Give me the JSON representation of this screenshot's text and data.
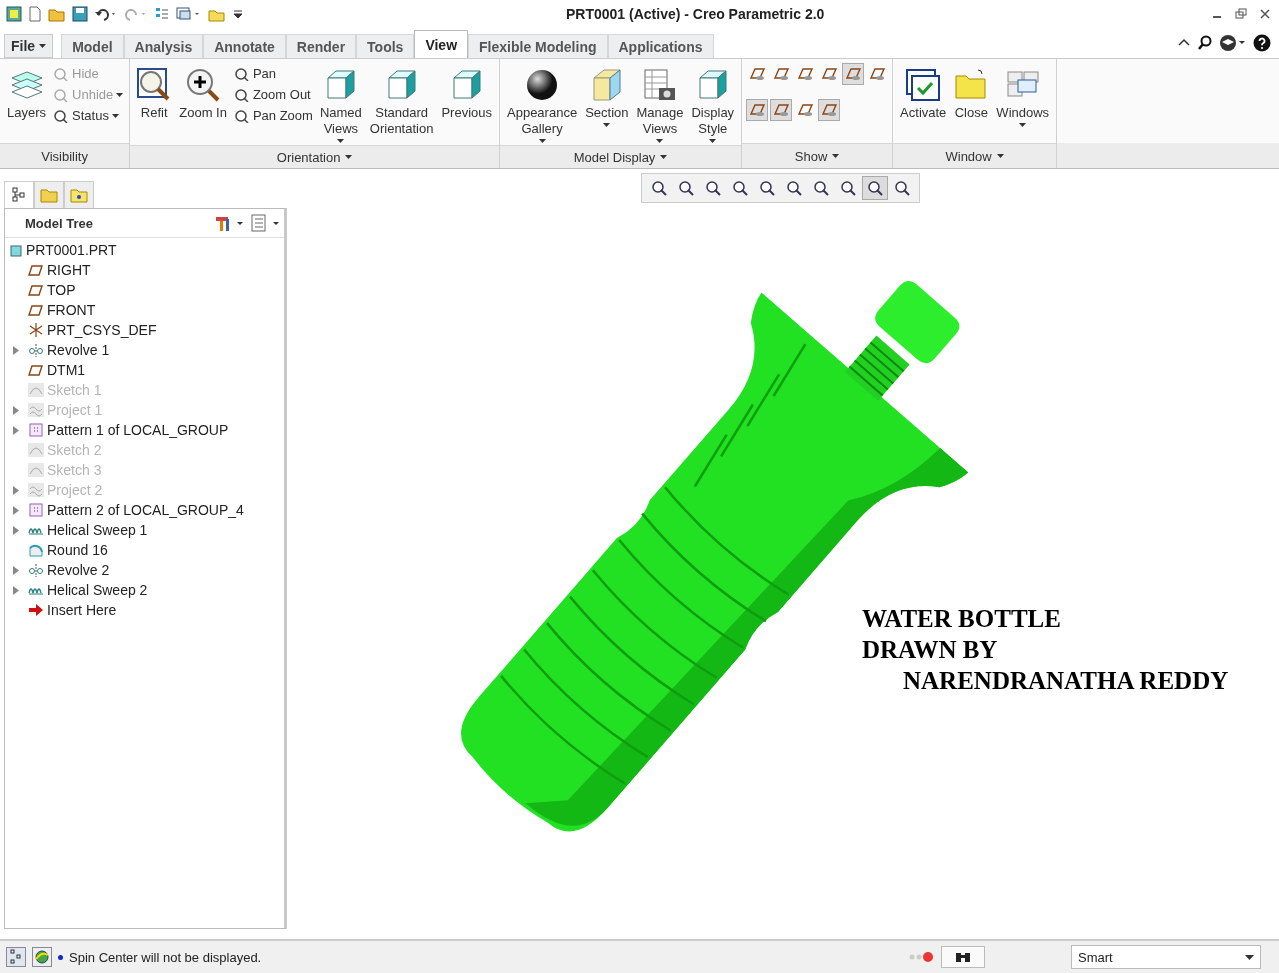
{
  "window": {
    "title": "PRT0001 (Active) - Creo Parametric 2.0"
  },
  "file_menu": {
    "label": "File"
  },
  "tabs": [
    {
      "label": "Model",
      "selected": false
    },
    {
      "label": "Analysis",
      "selected": false
    },
    {
      "label": "Annotate",
      "selected": false
    },
    {
      "label": "Render",
      "selected": false
    },
    {
      "label": "Tools",
      "selected": false
    },
    {
      "label": "View",
      "selected": true
    },
    {
      "label": "Flexible Modeling",
      "selected": false
    },
    {
      "label": "Applications",
      "selected": false
    }
  ],
  "ribbon": [
    {
      "label": "Visibility",
      "menu": false,
      "items": [
        {
          "kind": "large",
          "label": "Layers",
          "dropdown": false
        },
        {
          "kind": "stack",
          "items": [
            {
              "label": "Hide",
              "disabled": true,
              "dropdown": false
            },
            {
              "label": "Unhide",
              "disabled": true,
              "dropdown": true
            },
            {
              "label": "Status",
              "disabled": false,
              "dropdown": true
            }
          ]
        }
      ]
    },
    {
      "label": "Orientation",
      "menu": true,
      "items": [
        {
          "kind": "large",
          "label": "Refit",
          "dropdown": false
        },
        {
          "kind": "large",
          "label": "Zoom In",
          "dropdown": false
        },
        {
          "kind": "stack",
          "items": [
            {
              "label": "Pan",
              "disabled": false,
              "dropdown": false
            },
            {
              "label": "Zoom Out",
              "disabled": false,
              "dropdown": false
            },
            {
              "label": "Pan Zoom",
              "disabled": false,
              "dropdown": false
            }
          ]
        },
        {
          "kind": "large",
          "label": "Named\nViews",
          "dropdown": true
        },
        {
          "kind": "large",
          "label": "Standard\nOrientation",
          "dropdown": false
        },
        {
          "kind": "large",
          "label": "Previous",
          "dropdown": false
        }
      ]
    },
    {
      "label": "Model Display",
      "menu": true,
      "items": [
        {
          "kind": "large",
          "label": "Appearance\nGallery",
          "dropdown": true
        },
        {
          "kind": "large",
          "label": "Section",
          "dropdown": true
        },
        {
          "kind": "large",
          "label": "Manage\nViews",
          "dropdown": true
        },
        {
          "kind": "large",
          "label": "Display\nStyle",
          "dropdown": true
        }
      ]
    },
    {
      "label": "Show",
      "menu": true,
      "items": [
        {
          "kind": "toggles",
          "rows": [
            [
              {
                "selected": false
              },
              {
                "selected": false
              },
              {
                "selected": false
              },
              {
                "selected": false
              },
              {
                "selected": true
              },
              {
                "selected": false
              }
            ],
            [
              {
                "selected": true
              },
              {
                "selected": true
              },
              {
                "selected": false
              },
              {
                "selected": true
              }
            ]
          ]
        }
      ]
    },
    {
      "label": "Window",
      "menu": true,
      "items": [
        {
          "kind": "large",
          "label": "Activate",
          "dropdown": false
        },
        {
          "kind": "large",
          "label": "Close",
          "dropdown": false
        },
        {
          "kind": "large",
          "label": "Windows",
          "dropdown": true
        }
      ]
    }
  ],
  "model_tree": {
    "title": "Model Tree",
    "items": [
      {
        "label": "PRT0001.PRT",
        "kind": "part",
        "dimmed": false,
        "children": [
          {
            "label": "RIGHT",
            "kind": "plane",
            "expandable": false,
            "dimmed": false
          },
          {
            "label": "TOP",
            "kind": "plane",
            "expandable": false,
            "dimmed": false
          },
          {
            "label": "FRONT",
            "kind": "plane",
            "expandable": false,
            "dimmed": false
          },
          {
            "label": "PRT_CSYS_DEF",
            "kind": "csys",
            "expandable": false,
            "dimmed": false
          },
          {
            "label": "Revolve 1",
            "kind": "revolve",
            "expandable": true,
            "dimmed": false
          },
          {
            "label": "DTM1",
            "kind": "plane",
            "expandable": false,
            "dimmed": false
          },
          {
            "label": "Sketch 1",
            "kind": "sketch",
            "expandable": false,
            "dimmed": true
          },
          {
            "label": "Project 1",
            "kind": "project",
            "expandable": true,
            "dimmed": true
          },
          {
            "label": "Pattern 1 of LOCAL_GROUP",
            "kind": "pattern",
            "expandable": true,
            "dimmed": false
          },
          {
            "label": "Sketch 2",
            "kind": "sketch",
            "expandable": false,
            "dimmed": true
          },
          {
            "label": "Sketch 3",
            "kind": "sketch",
            "expandable": false,
            "dimmed": true
          },
          {
            "label": "Project 2",
            "kind": "project",
            "expandable": true,
            "dimmed": true
          },
          {
            "label": "Pattern 2 of LOCAL_GROUP_4",
            "kind": "pattern",
            "expandable": true,
            "dimmed": false
          },
          {
            "label": "Helical Sweep 1",
            "kind": "helical",
            "expandable": true,
            "dimmed": false
          },
          {
            "label": "Round 16",
            "kind": "round",
            "expandable": false,
            "dimmed": false
          },
          {
            "label": "Revolve 2",
            "kind": "revolve",
            "expandable": true,
            "dimmed": false
          },
          {
            "label": "Helical Sweep 2",
            "kind": "helical",
            "expandable": true,
            "dimmed": false
          },
          {
            "label": "Insert Here",
            "kind": "insert",
            "expandable": false,
            "dimmed": false
          }
        ]
      }
    ]
  },
  "view_toolbar": [
    {
      "selected": false
    },
    {
      "selected": false
    },
    {
      "selected": false
    },
    {
      "selected": false
    },
    {
      "selected": false
    },
    {
      "selected": false
    },
    {
      "selected": false
    },
    {
      "selected": false
    },
    {
      "selected": true
    },
    {
      "selected": false
    }
  ],
  "annotation": [
    "WATER BOTTLE",
    "DRAWN BY",
    "NARENDRANATHA REDDY"
  ],
  "status_bar": {
    "message": "Spin Center will not be displayed.",
    "filter": "Smart"
  }
}
